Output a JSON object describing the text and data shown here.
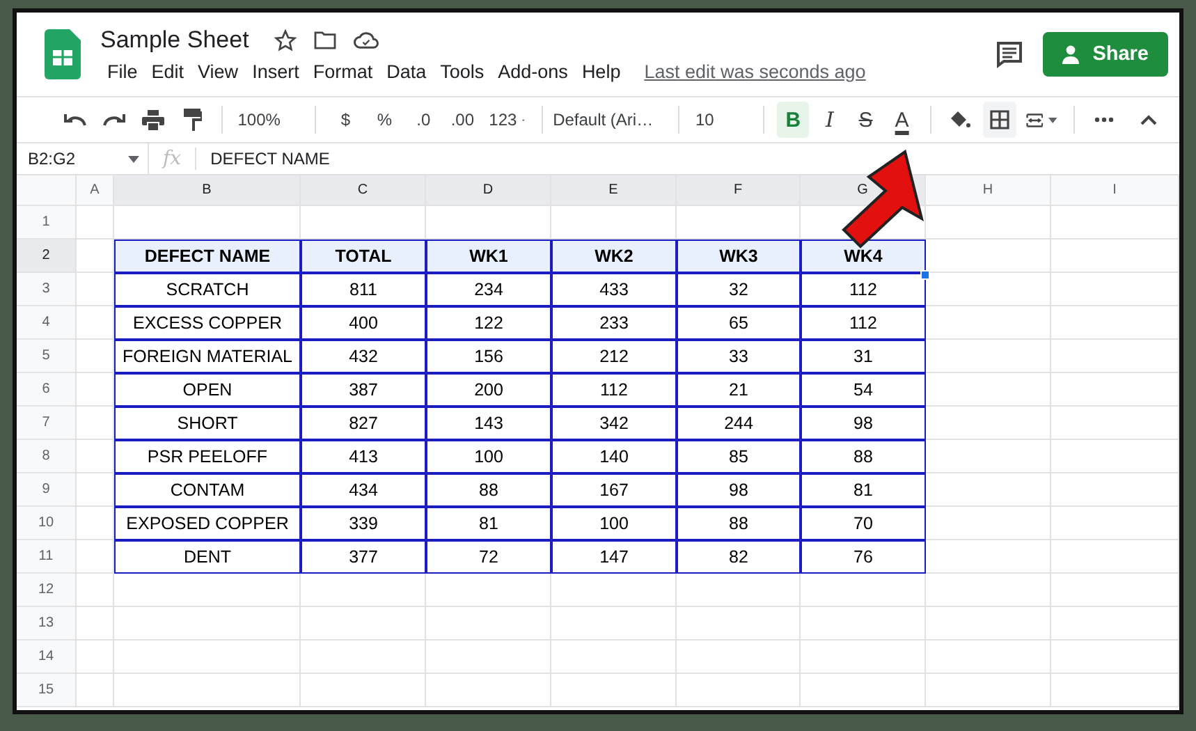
{
  "app": {
    "title": "Sample Sheet",
    "menu": [
      "File",
      "Edit",
      "View",
      "Insert",
      "Format",
      "Data",
      "Tools",
      "Add-ons",
      "Help"
    ],
    "last_edit": "Last edit was seconds ago",
    "share": "Share"
  },
  "toolbar": {
    "zoom": "100%",
    "currency": "$",
    "percent": "%",
    "decimal_decrease": ".0",
    "decimal_increase": ".00",
    "number_format": "123",
    "font": "Default (Ari…",
    "font_size": "10",
    "format_buttons": [
      {
        "kind": "bold",
        "label": "B",
        "selected": true
      },
      {
        "kind": "italic",
        "label": "I",
        "selected": false
      },
      {
        "kind": "strike",
        "label": "S",
        "selected": false
      },
      {
        "kind": "text_color",
        "label": "A",
        "selected": false
      }
    ],
    "borders_selected": true
  },
  "formula_bar": {
    "name_box": "B2:G2",
    "fx": "fx",
    "value": "DEFECT NAME"
  },
  "grid": {
    "columns": [
      {
        "label": "A",
        "selected": false
      },
      {
        "label": "B",
        "selected": true
      },
      {
        "label": "C",
        "selected": true
      },
      {
        "label": "D",
        "selected": true
      },
      {
        "label": "E",
        "selected": true
      },
      {
        "label": "F",
        "selected": true
      },
      {
        "label": "G",
        "selected": true
      },
      {
        "label": "H",
        "selected": false
      },
      {
        "label": "I",
        "selected": false
      }
    ],
    "row_numbers": [
      {
        "label": "1",
        "selected": false
      },
      {
        "label": "2",
        "selected": true
      },
      {
        "label": "3",
        "selected": false
      },
      {
        "label": "4",
        "selected": false
      },
      {
        "label": "5",
        "selected": false
      },
      {
        "label": "6",
        "selected": false
      },
      {
        "label": "7",
        "selected": false
      },
      {
        "label": "8",
        "selected": false
      },
      {
        "label": "9",
        "selected": false
      },
      {
        "label": "10",
        "selected": false
      },
      {
        "label": "11",
        "selected": false
      },
      {
        "label": "12",
        "selected": false
      },
      {
        "label": "13",
        "selected": false
      },
      {
        "label": "14",
        "selected": false
      },
      {
        "label": "15",
        "selected": false
      }
    ],
    "table_header": [
      "DEFECT NAME",
      "TOTAL",
      "WK1",
      "WK2",
      "WK3",
      "WK4"
    ],
    "table_rows": [
      [
        "SCRATCH",
        "811",
        "234",
        "433",
        "32",
        "112"
      ],
      [
        "EXCESS COPPER",
        "400",
        "122",
        "233",
        "65",
        "112"
      ],
      [
        "FOREIGN MATERIAL",
        "432",
        "156",
        "212",
        "33",
        "31"
      ],
      [
        "OPEN",
        "387",
        "200",
        "112",
        "21",
        "54"
      ],
      [
        "SHORT",
        "827",
        "143",
        "342",
        "244",
        "98"
      ],
      [
        "PSR PEELOFF",
        "413",
        "100",
        "140",
        "85",
        "88"
      ],
      [
        "CONTAM",
        "434",
        "88",
        "167",
        "98",
        "81"
      ],
      [
        "EXPOSED COPPER",
        "339",
        "81",
        "100",
        "88",
        "70"
      ],
      [
        "DENT",
        "377",
        "72",
        "147",
        "82",
        "76"
      ]
    ]
  }
}
